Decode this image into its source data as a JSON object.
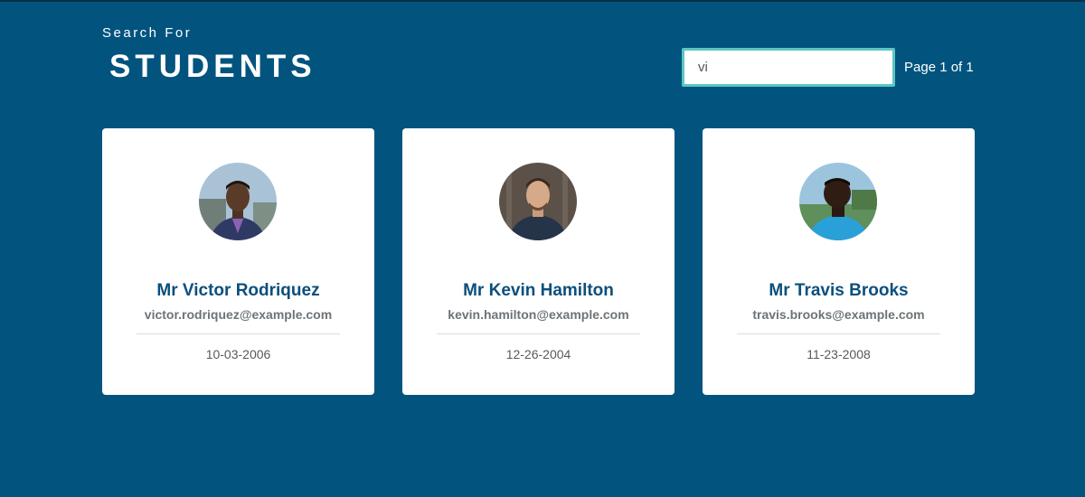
{
  "header": {
    "subtitle": "Search For",
    "title": "STUDENTS"
  },
  "search": {
    "value": "vi",
    "placeholder": ""
  },
  "pager": {
    "label": "Page 1 of 1"
  },
  "students": [
    {
      "name": "Mr Victor Rodriquez",
      "email": "victor.rodriquez@example.com",
      "dob": "10-03-2006",
      "avatar_icon": "avatar-photo"
    },
    {
      "name": "Mr Kevin Hamilton",
      "email": "kevin.hamilton@example.com",
      "dob": "12-26-2004",
      "avatar_icon": "avatar-photo"
    },
    {
      "name": "Mr Travis Brooks",
      "email": "travis.brooks@example.com",
      "dob": "11-23-2008",
      "avatar_icon": "avatar-photo"
    }
  ],
  "colors": {
    "background": "#02547f",
    "accent": "#5cc6c3",
    "name_text": "#0b4f7c"
  }
}
